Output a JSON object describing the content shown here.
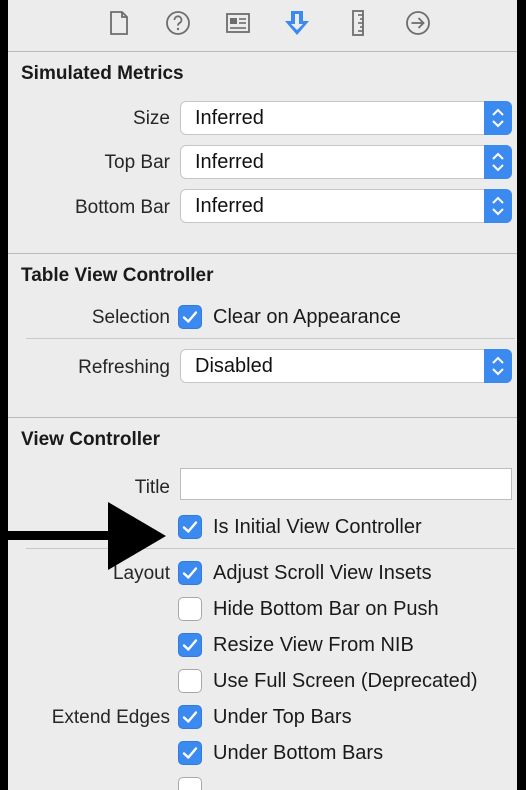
{
  "toolbar": {
    "icons": [
      "file-inspector-icon",
      "quick-help-icon",
      "identity-inspector-icon",
      "attributes-inspector-icon",
      "size-inspector-icon",
      "connections-inspector-icon"
    ],
    "active": "attributes-inspector-icon",
    "accent": "#3b8af0"
  },
  "simulated_metrics": {
    "title": "Simulated Metrics",
    "size_label": "Size",
    "size_value": "Inferred",
    "top_bar_label": "Top Bar",
    "top_bar_value": "Inferred",
    "bottom_bar_label": "Bottom Bar",
    "bottom_bar_value": "Inferred"
  },
  "table_view_controller": {
    "title": "Table View Controller",
    "selection_label": "Selection",
    "clear_on_appearance": {
      "label": "Clear on Appearance",
      "checked": true
    },
    "refreshing_label": "Refreshing",
    "refreshing_value": "Disabled"
  },
  "view_controller": {
    "title": "View Controller",
    "title_field_label": "Title",
    "title_field_value": "",
    "initial_vc": {
      "label": "Is Initial View Controller",
      "checked": true
    },
    "layout_label": "Layout",
    "layout_options": [
      {
        "label": "Adjust Scroll View Insets",
        "checked": true
      },
      {
        "label": "Hide Bottom Bar on Push",
        "checked": false
      },
      {
        "label": "Resize View From NIB",
        "checked": true
      },
      {
        "label": "Use Full Screen (Deprecated)",
        "checked": false
      }
    ],
    "extend_edges_label": "Extend Edges",
    "extend_edges_options": [
      {
        "label": "Under Top Bars",
        "checked": true
      },
      {
        "label": "Under Bottom Bars",
        "checked": true
      }
    ]
  },
  "colors": {
    "checkbox_on": "#3b8af0",
    "panel_bg": "#ececec",
    "frame": "#000000"
  }
}
